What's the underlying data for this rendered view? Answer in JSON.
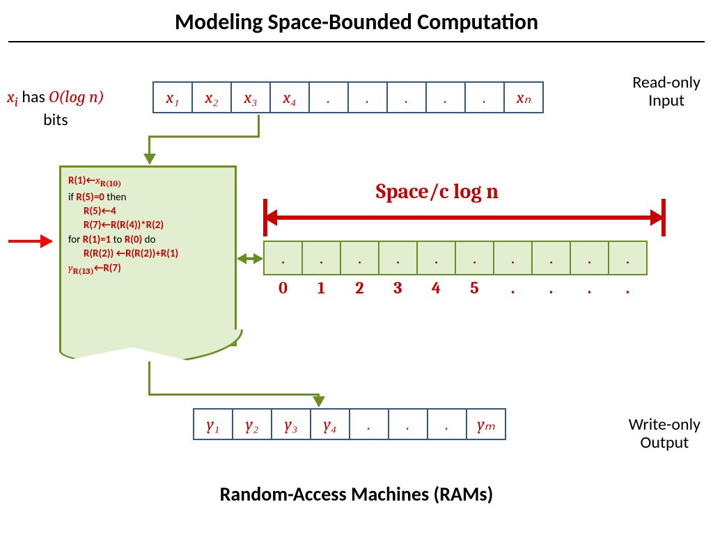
{
  "title": "Modeling Space-Bounded Computation",
  "subtitle": "Random-Access Machines (RAMs)",
  "xi_note": {
    "xi": "x",
    "i": "i",
    "has": " has ",
    "olog": "O(log n)",
    "bits": "bits"
  },
  "input_label_l1": "Read-only",
  "input_label_l2": "Input",
  "output_label_l1": "Write-only",
  "output_label_l2": "Output",
  "input_cells": [
    "x₁",
    "x₂",
    "x₃",
    "x₄",
    ".",
    ".",
    ".",
    ".",
    ".",
    "xₙ"
  ],
  "output_cells": [
    "y₁",
    "y₂",
    "y₃",
    "y₄",
    ".",
    ".",
    ".",
    "yₘ"
  ],
  "space_label_a": "Space",
  "space_label_b": "/c log n",
  "workspace_cells": [
    ".",
    ".",
    ".",
    ".",
    ".",
    ".",
    ".",
    ".",
    ".",
    "."
  ],
  "workspace_index": [
    "0",
    "1",
    "2",
    "3",
    "4",
    "5",
    ".",
    ".",
    ".",
    "."
  ],
  "program": {
    "l1a": "R(1)",
    "l1b": "←",
    "l1c": "x",
    "l1d": "R(10)",
    "l2a": "if ",
    "l2b": "R(5)=0",
    "l2c": " then",
    "l3a": "R(5)",
    "l3b": "←",
    "l3c": "4",
    "l4a": "R(7)",
    "l4b": "←",
    "l4c": "R(R(4))*R(2)",
    "l5a": "for ",
    "l5b": "R(1)=1",
    "l5c": " to ",
    "l5d": "R(0)",
    "l5e": " do",
    "l6a": "R(R(2))",
    "l6b": " ←",
    "l6c": "R(R(2))+R(1)",
    "l7a": "y",
    "l7b": "R(13)",
    "l7c": "←",
    "l7d": "R(7)"
  }
}
